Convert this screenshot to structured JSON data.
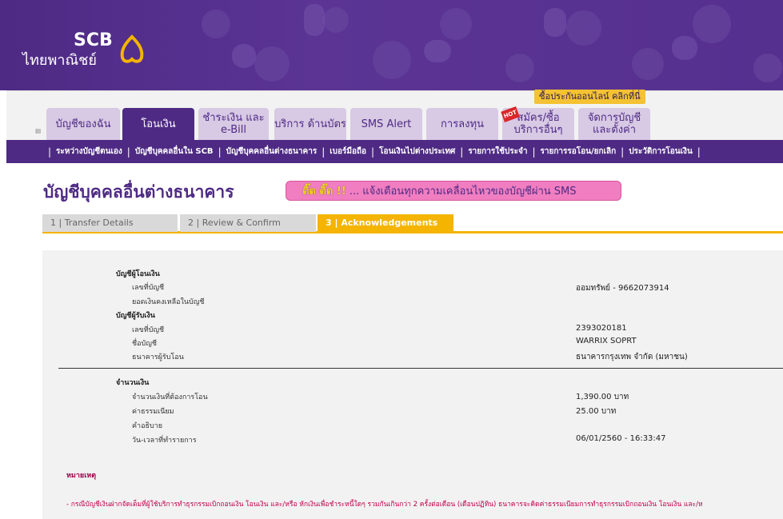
{
  "brand": {
    "name_en": "SCB",
    "name_th": "ไทยพาณิชย์"
  },
  "promo": "ซื้อประกันออนไลน์ คลิกที่นี่",
  "tab_marker": "III",
  "tabs": [
    {
      "label": "บัญชีของฉัน"
    },
    {
      "label": "โอนเงิน"
    },
    {
      "label": "ชำระเงิน และ e-Bill"
    },
    {
      "label": "บริการ ด้านบัตร"
    },
    {
      "label": "SMS Alert"
    },
    {
      "label": "การลงทุน"
    },
    {
      "label": "สมัคร/ซื้อ บริการอื่นๆ"
    },
    {
      "label": "จัดการบัญชี และตั้งค่า"
    }
  ],
  "hot_badge": "HOT",
  "subnav": [
    "ระหว่างบัญชีตนเอง",
    "บัญชีบุคคลอื่นใน SCB",
    "บัญชีบุคคลอื่นต่างธนาคาร",
    "เบอร์มือถือ",
    "โอนเงินไปต่างประเทศ",
    "รายการใช้ประจำ",
    "รายการรอโอน/ยกเลิก",
    "ประวัติการโอนเงิน"
  ],
  "page_title": "บัญชีบุคคลอื่นต่างธนาคาร",
  "sms_banner": {
    "ring": "ติ๊ด ติ๊ด !!",
    "text": "... แจ้งเตือนทุกความเคลื่อนไหวของบัญชีผ่าน SMS"
  },
  "steps": [
    "1 | Transfer Details",
    "2 | Review & Confirm",
    "3 | Acknowledgements"
  ],
  "details": {
    "from_header": "บัญชีผู้โอนเงิน",
    "from_account_label": "เลขที่บัญชี",
    "from_account_value": "ออมทรัพย์ - 9662073914",
    "balance_label": "ยอดเงินคงเหลือในบัญชี",
    "to_header": "บัญชีผู้รับเงิน",
    "to_account_label": "เลขที่บัญชี",
    "to_account_value": "2393020181",
    "to_name_label": "ชื่อบัญชี",
    "to_name_value": "WARRIX SOPRT",
    "to_bank_label": "ธนาคารผู้รับโอน",
    "to_bank_value": "ธนาคารกรุงเทพ จำกัด (มหาชน)",
    "amount_header": "จำนวนเงิน",
    "amount_label": "จำนวนเงินที่ต้องการโอน",
    "amount_value": "1,390.00  บาท",
    "fee_label": "ค่าธรรมเนียม",
    "fee_value": "25.00  บาท",
    "desc_label": "คำอธิบาย",
    "datetime_label": "วัน-เวลาที่ทำรายการ",
    "datetime_value": "06/01/2560 - 16:33:47"
  },
  "remark": {
    "title": "หมายเหตุ",
    "body": "- กรณีบัญชีเงินฝากจัดเต็มที่ผู้ใช้บริการทำธุรกรรมเบิกถอนเงิน โอนเงิน และ/หรือ หักเงินเพื่อชำระหนี้ใดๆ รวมกันเกินกว่า 2 ครั้งต่อเดือน (เดือนปฏิทิน) ธนาคารจะคิดค่าธรรมเนียมการทำธุรกรรมเบิกถอนเงิน โอนเงิน และ/ห"
  },
  "colors": {
    "brand_purple": "#4e2a84",
    "tab_inactive": "#d8c9e4",
    "step_active": "#f4b400",
    "promo": "#f4c232",
    "sms_banner": "#f07ec0",
    "remark": "#c0004a"
  }
}
